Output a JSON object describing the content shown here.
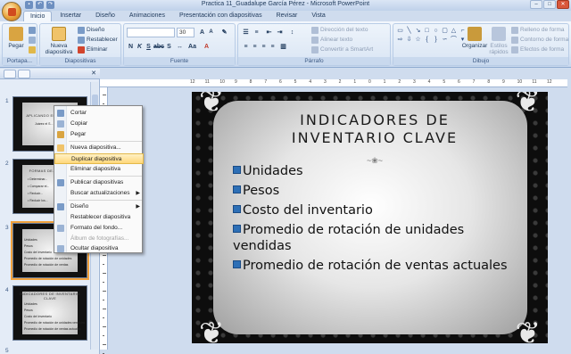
{
  "window": {
    "title": "Practica 11_Guadalupe García Pérez - Microsoft PowerPoint"
  },
  "tabs": [
    "Inicio",
    "Insertar",
    "Diseño",
    "Animaciones",
    "Presentación con diapositivas",
    "Revisar",
    "Vista"
  ],
  "ribbon": {
    "portapapeles": {
      "label": "Portapa...",
      "paste": "Pegar"
    },
    "diapositivas": {
      "label": "Diapositivas",
      "new_slide": "Nueva diapositiva",
      "layout": "Diseño",
      "reset": "Restablecer",
      "delete": "Eliminar"
    },
    "fuente": {
      "label": "Fuente",
      "font_size": "30"
    },
    "parrafo": {
      "label": "Párrafo",
      "text_direction": "Dirección del texto",
      "align_text": "Alinear texto",
      "smartart": "Convertir a SmartArt"
    },
    "dibujo": {
      "label": "Dibujo",
      "arrange": "Organizar",
      "quick_styles": "Estilos rápidos",
      "shape_fill": "Relleno de forma",
      "shape_outline": "Contorno de forma",
      "shape_effects": "Efectos de forma"
    }
  },
  "ruler": {
    "numbers": [
      "12",
      "11",
      "10",
      "9",
      "8",
      "7",
      "6",
      "5",
      "4",
      "3",
      "2",
      "1",
      "0",
      "1",
      "2",
      "3",
      "4",
      "5",
      "6",
      "7",
      "8",
      "9",
      "10",
      "11",
      "12"
    ]
  },
  "slide_numbers": [
    "1",
    "2",
    "3",
    "4",
    "5"
  ],
  "thumbnails": [
    {
      "title": "APLICANDO EL CORPOR",
      "lines": [
        "Juárez el S..."
      ]
    },
    {
      "title": "FORMAS DE... EFECT",
      "lines": [
        "• Determinar...",
        "• Comparar el...",
        "• Reducir...",
        "• Reducir los..."
      ]
    },
    {
      "title": "",
      "lines": [
        "Unidades",
        "Pesos",
        "Costo del inventario",
        "Promedio de rotación de unidades",
        "Promedio de rotación de ventas"
      ]
    },
    {
      "title": "INDICADORES DE INVENTARIO CLAVE",
      "lines": [
        "Unidades",
        "Pesos",
        "Costo del inventario",
        "Promedio de rotación de unidades vendidas",
        "Promedio de rotación de ventas actuales"
      ]
    }
  ],
  "context_menu": [
    {
      "label": "Cortar",
      "disabled": false
    },
    {
      "label": "Copiar",
      "disabled": false
    },
    {
      "label": "Pegar",
      "disabled": false
    },
    {
      "label": "Nueva diapositiva...",
      "disabled": false
    },
    {
      "label": "Duplicar diapositiva",
      "disabled": false,
      "hover": true
    },
    {
      "label": "Eliminar diapositiva",
      "disabled": false
    },
    {
      "label": "Publicar diapositivas",
      "disabled": false
    },
    {
      "label": "Buscar actualizaciones",
      "disabled": false,
      "submenu": true
    },
    {
      "label": "Diseño",
      "disabled": false,
      "submenu": true
    },
    {
      "label": "Restablecer diapositiva",
      "disabled": false
    },
    {
      "label": "Formato del fondo...",
      "disabled": false
    },
    {
      "label": "Álbum de fotografías...",
      "disabled": true
    },
    {
      "label": "Ocultar diapositiva",
      "disabled": false
    }
  ],
  "slide": {
    "title_line1": "INDICADORES DE",
    "title_line2": "INVENTARIO CLAVE",
    "bullets": [
      "Unidades",
      "Pesos",
      "Costo del inventario",
      "Promedio de rotación de unidades vendidas",
      "Promedio de rotación de ventas actuales"
    ]
  },
  "colors": {
    "ribbon_bg": "#dde8f6",
    "menu_hover": "#ffd77a",
    "bullet": "#2d6fb6",
    "selected_thumb": "#f2a23c"
  }
}
